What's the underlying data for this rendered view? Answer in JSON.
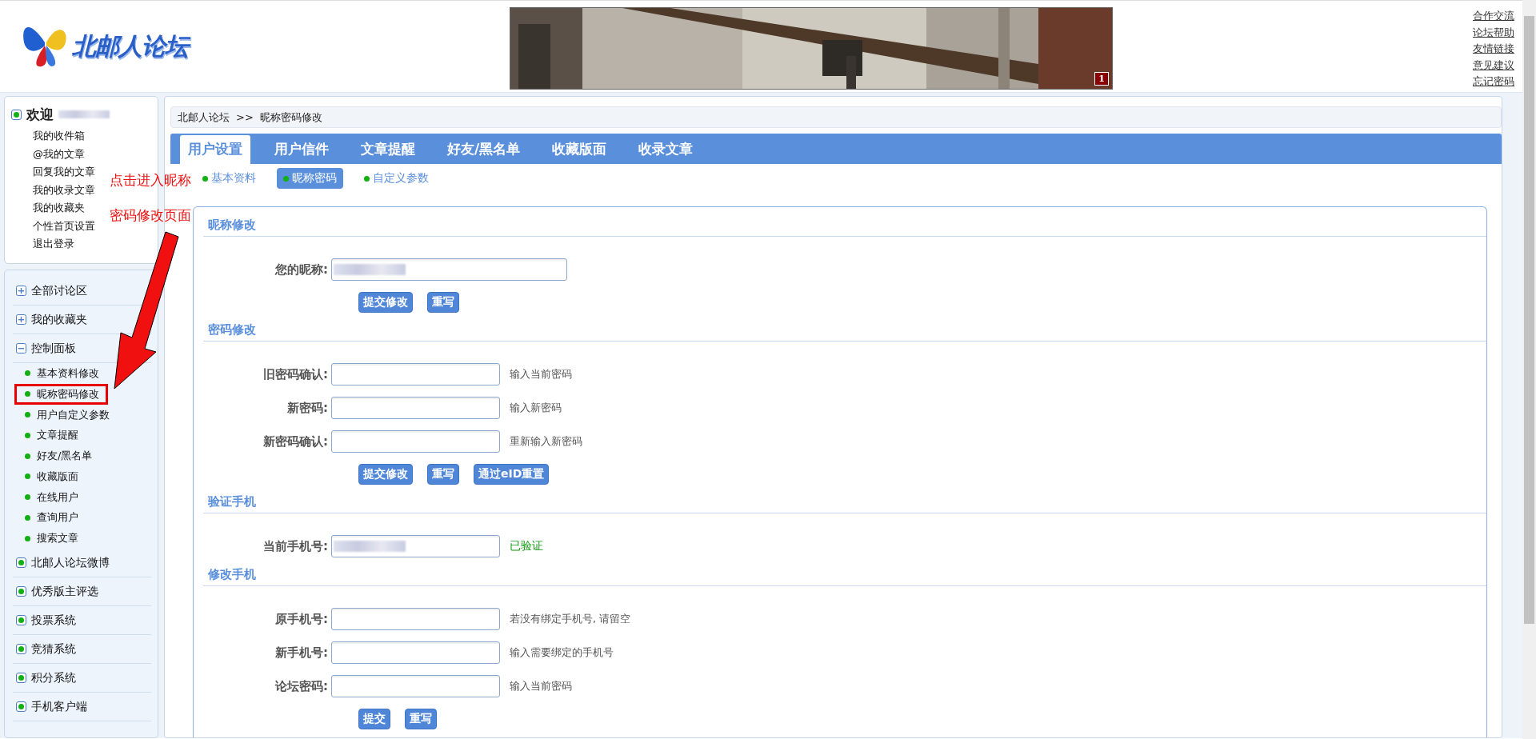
{
  "header": {
    "logo_text": "北邮人论坛",
    "banner": {
      "kind": "picture",
      "page_badge": "1"
    },
    "links": [
      "合作交流",
      "论坛帮助",
      "友情链接",
      "意见建议",
      "忘记密码"
    ]
  },
  "sidebar": {
    "welcome": "欢迎",
    "welcome_links": [
      "我的收件箱",
      "@我的文章",
      "回复我的文章",
      "我的收录文章",
      "我的收藏夹",
      "个性首页设置",
      "退出登录"
    ],
    "groups": [
      {
        "label": "全部讨论区",
        "kind": "plus"
      },
      {
        "label": "我的收藏夹",
        "kind": "plus"
      },
      {
        "label": "控制面板",
        "kind": "minus",
        "children": [
          {
            "label": "基本资料修改",
            "highlighted": false
          },
          {
            "label": "昵称密码修改",
            "highlighted": true
          },
          {
            "label": "用户自定义参数",
            "highlighted": false
          },
          {
            "label": "文章提醒",
            "highlighted": false
          },
          {
            "label": "好友/黑名单",
            "highlighted": false
          },
          {
            "label": "收藏版面",
            "highlighted": false
          },
          {
            "label": "在线用户",
            "highlighted": false
          },
          {
            "label": "查询用户",
            "highlighted": false
          },
          {
            "label": "搜索文章",
            "highlighted": false
          }
        ]
      },
      {
        "label": "北邮人论坛微博",
        "kind": "box"
      },
      {
        "label": "优秀版主评选",
        "kind": "box"
      },
      {
        "label": "投票系统",
        "kind": "box"
      },
      {
        "label": "竞猜系统",
        "kind": "box"
      },
      {
        "label": "积分系统",
        "kind": "box"
      },
      {
        "label": "手机客户端",
        "kind": "box"
      }
    ]
  },
  "annotation": {
    "lines": [
      "点击进入昵称",
      "密码修改页面"
    ]
  },
  "breadcrumb": [
    "北邮人论坛",
    ">>",
    "昵称密码修改"
  ],
  "tabs": [
    {
      "label": "用户设置",
      "selected": true
    },
    {
      "label": "用户信件",
      "selected": false
    },
    {
      "label": "文章提醒",
      "selected": false
    },
    {
      "label": "好友/黑名单",
      "selected": false
    },
    {
      "label": "收藏版面",
      "selected": false
    },
    {
      "label": "收录文章",
      "selected": false
    }
  ],
  "sub_tabs": [
    {
      "label": "基本资料",
      "selected": false
    },
    {
      "label": "昵称密码",
      "selected": true
    },
    {
      "label": "自定义参数",
      "selected": false
    }
  ],
  "sections": [
    {
      "title": "昵称修改",
      "rows": [
        {
          "label": "您的昵称:",
          "redacted": true,
          "wide": true
        }
      ],
      "buttons": [
        "提交修改",
        "重写"
      ]
    },
    {
      "title": "密码修改",
      "rows": [
        {
          "label": "旧密码确认:",
          "hint": "输入当前密码"
        },
        {
          "label": "新密码:",
          "hint": "输入新密码"
        },
        {
          "label": "新密码确认:",
          "hint": "重新输入新密码"
        }
      ],
      "buttons": [
        "提交修改",
        "重写",
        "通过eID重置"
      ]
    },
    {
      "title": "验证手机",
      "rows": [
        {
          "label": "当前手机号:",
          "redacted": true,
          "status": "已验证"
        }
      ]
    },
    {
      "title": "修改手机",
      "rows": [
        {
          "label": "原手机号:",
          "hint": "若没有绑定手机号, 请留空"
        },
        {
          "label": "新手机号:",
          "hint": "输入需要绑定的手机号"
        },
        {
          "label": "论坛密码:",
          "hint": "输入当前密码"
        }
      ],
      "buttons": [
        "提交",
        "重写"
      ]
    }
  ]
}
